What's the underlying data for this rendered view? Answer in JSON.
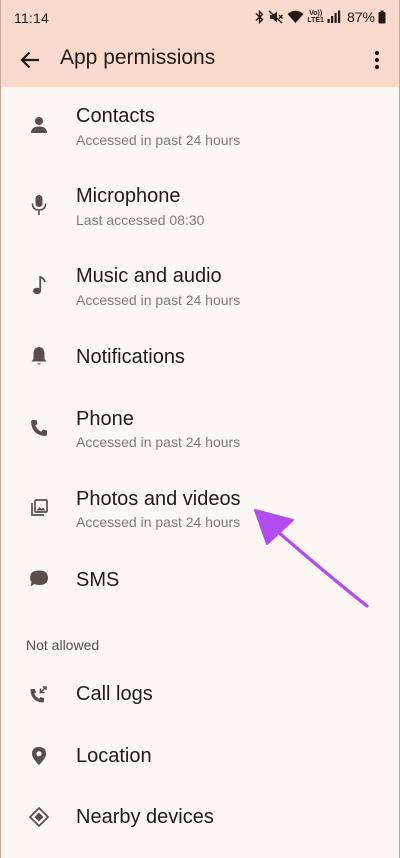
{
  "status_bar": {
    "time": "11:14",
    "volte_top": "Vo))",
    "volte_bottom": "LTE1",
    "battery": "87%"
  },
  "app_bar": {
    "title": "App permissions"
  },
  "allowed": [
    {
      "title": "Contacts",
      "subtitle": "Accessed in past 24 hours",
      "icon": "person-icon"
    },
    {
      "title": "Microphone",
      "subtitle": "Last accessed 08:30",
      "icon": "microphone-icon"
    },
    {
      "title": "Music and audio",
      "subtitle": "Accessed in past 24 hours",
      "icon": "music-note-icon"
    },
    {
      "title": "Notifications",
      "subtitle": "",
      "icon": "bell-icon"
    },
    {
      "title": "Phone",
      "subtitle": "Accessed in past 24 hours",
      "icon": "phone-icon"
    },
    {
      "title": "Photos and videos",
      "subtitle": "Accessed in past 24 hours",
      "icon": "photos-icon"
    },
    {
      "title": "SMS",
      "subtitle": "",
      "icon": "chat-bubble-icon"
    }
  ],
  "not_allowed_header": "Not allowed",
  "not_allowed": [
    {
      "title": "Call logs",
      "icon": "call-log-icon"
    },
    {
      "title": "Location",
      "icon": "location-pin-icon"
    },
    {
      "title": "Nearby devices",
      "icon": "nearby-devices-icon"
    }
  ],
  "colors": {
    "header_bg": "#f8dacd",
    "page_bg": "#fcf7f5",
    "icon": "#5b4d49",
    "annotation_arrow": "#b34cf0"
  }
}
